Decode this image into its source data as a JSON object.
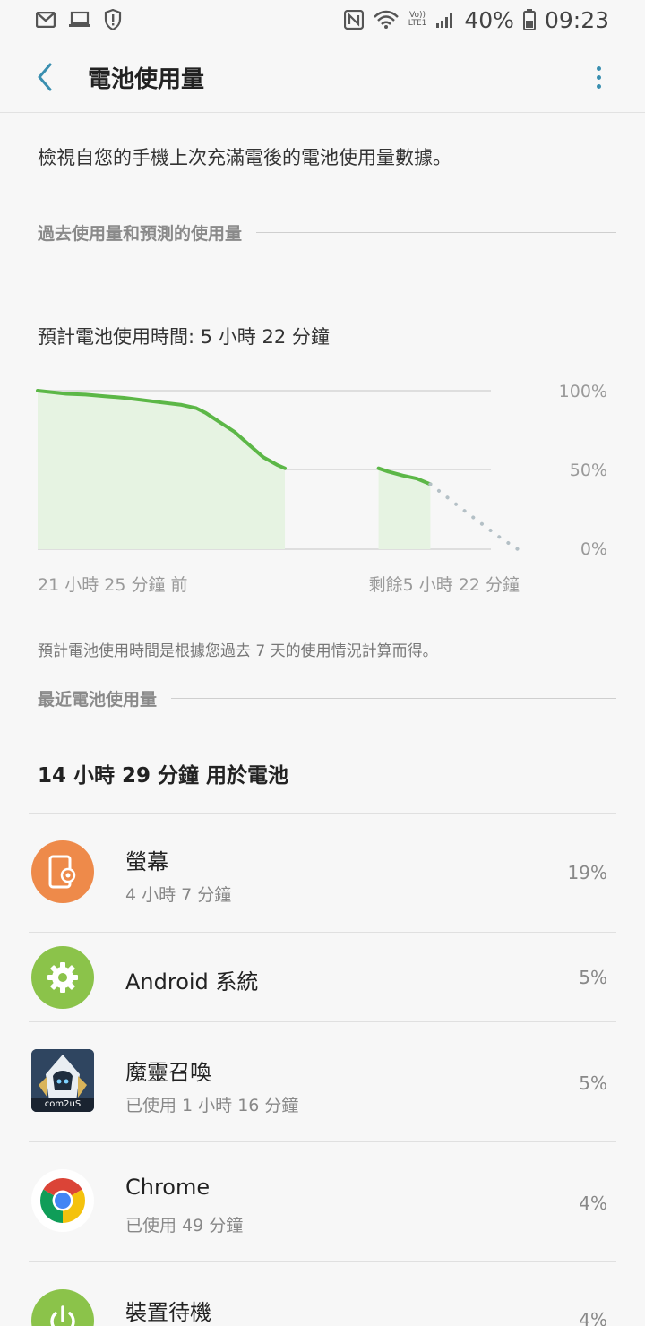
{
  "status_bar": {
    "battery_percent": "40%",
    "time": "09:23",
    "volte_label": "Vo))",
    "lte_label": "LTE1"
  },
  "app_bar": {
    "title": "電池使用量"
  },
  "intro_text": "檢視自您的手機上次充滿電後的電池使用量數據。",
  "section_past": {
    "label": "過去使用量和預測的使用量"
  },
  "estimate_text": "預計電池使用時間: 5 小時 22 分鐘",
  "chart": {
    "y_labels": [
      "100%",
      "50%",
      "0%"
    ],
    "x_left_label": "21 小時 25 分鐘 前",
    "x_right_label": "剩餘5 小時 22 分鐘",
    "line_color": "#5cb747",
    "fill_color": "#e6f3e2",
    "prediction_color": "#b4c0c6"
  },
  "chart_data": {
    "type": "line",
    "ylim": [
      0,
      100
    ],
    "y_ticks": [
      "100%",
      "50%",
      "0%"
    ],
    "x_labels": [
      "21 小時 25 分鐘 前",
      "剩餘5 小時 22 分鐘"
    ],
    "xlim": [
      0,
      100
    ],
    "series": [
      {
        "values": [
          [
            0,
            100
          ],
          [
            3,
            99
          ],
          [
            6,
            98
          ],
          [
            10,
            97.5
          ],
          [
            14,
            96.5
          ],
          [
            18,
            95.5
          ],
          [
            22,
            94
          ],
          [
            26,
            92.5
          ],
          [
            30,
            91
          ],
          [
            33,
            89
          ],
          [
            35,
            86
          ],
          [
            38,
            80
          ],
          [
            41,
            74
          ],
          [
            44,
            66
          ],
          [
            47,
            58
          ],
          [
            50,
            53
          ],
          [
            51.5,
            51
          ]
        ]
      },
      {
        "values": [
          [
            71,
            51
          ],
          [
            73,
            49
          ],
          [
            76,
            46.5
          ],
          [
            79,
            44.5
          ],
          [
            81,
            42
          ],
          [
            81.8,
            41
          ]
        ]
      },
      {
        "dashed": true,
        "values": [
          [
            81.8,
            41
          ],
          [
            89,
            24
          ],
          [
            96,
            8
          ],
          [
            100,
            0
          ]
        ]
      }
    ]
  },
  "footnote": "預計電池使用時間是根據您過去 7 天的使用情況計算而得。",
  "section_recent": {
    "label": "最近電池使用量"
  },
  "total_usage": "14 小時 29 分鐘 用於電池",
  "apps": [
    {
      "name": "螢幕",
      "sub": "4 小時 7 分鐘",
      "percent": "19%",
      "icon": "screen-icon",
      "color": "#ee8a4a"
    },
    {
      "name": "Android 系統",
      "sub": "",
      "percent": "5%",
      "icon": "gear-icon",
      "color": "#8bc34a"
    },
    {
      "name": "魔靈召喚",
      "sub": "已使用 1 小時 16 分鐘",
      "percent": "5%",
      "icon": "game-icon",
      "badge": "com2uS"
    },
    {
      "name": "Chrome",
      "sub": "已使用 49 分鐘",
      "percent": "4%",
      "icon": "chrome-icon"
    },
    {
      "name": "裝置待機",
      "sub": "",
      "percent": "4%",
      "icon": "power-icon",
      "color": "#8bc34a"
    }
  ]
}
